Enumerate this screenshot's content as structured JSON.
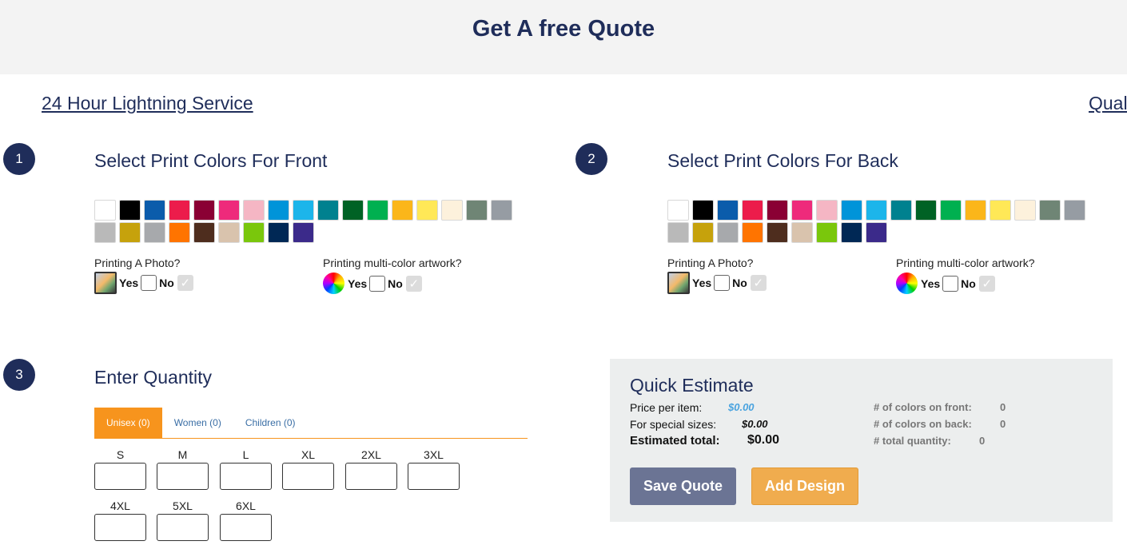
{
  "header": {
    "title": "Get A free Quote"
  },
  "promos": {
    "left": "24 Hour Lightning Service",
    "right": "Qual"
  },
  "steps": {
    "front": "1",
    "back": "2",
    "quantity": "3"
  },
  "front": {
    "title": "Select Print Colors For Front",
    "photo_label": "Printing A Photo?",
    "multicolor_label": "Printing multi-color artwork?",
    "yes": "Yes",
    "no": "No"
  },
  "back": {
    "title": "Select Print Colors For Back",
    "photo_label": "Printing A Photo?",
    "multicolor_label": "Printing multi-color artwork?",
    "yes": "Yes",
    "no": "No"
  },
  "swatch_colors": [
    "#ffffff",
    "#000000",
    "#0b5cab",
    "#ec1c4b",
    "#8a0034",
    "#ee2a7b",
    "#f5b6c4",
    "#0094d9",
    "#1cb5ea",
    "#00818f",
    "#006225",
    "#00b050",
    "#fbb61a",
    "#ffe857",
    "#fdf1dc",
    "#6f8575",
    "#969ca3",
    "#b9b9b9",
    "#c6a20c",
    "#a7a9ac",
    "#ff7400",
    "#4e2d1e",
    "#d9c3ad",
    "#7ac70c",
    "#002855",
    "#3b2a8a"
  ],
  "quantity": {
    "title": "Enter Quantity",
    "tabs": [
      "Unisex (0)",
      "Women (0)",
      "Children (0)"
    ],
    "sizes": [
      "S",
      "M",
      "L",
      "XL",
      "2XL",
      "3XL",
      "4XL",
      "5XL",
      "6XL"
    ]
  },
  "estimate": {
    "title": "Quick Estimate",
    "price_label": "Price per item:",
    "price_value": "$0.00",
    "special_label": "For special sizes:",
    "special_value": "$0.00",
    "total_label": "Estimated total:",
    "total_value": "$0.00",
    "front_colors_label": "# of colors on front:",
    "front_colors_value": "0",
    "back_colors_label": "# of colors on back:",
    "back_colors_value": "0",
    "total_qty_label": "# total quantity:",
    "total_qty_value": "0",
    "save_label": "Save Quote",
    "add_label": "Add Design"
  },
  "colors": {
    "navy": "#1f2d5a",
    "orange": "#f7941d",
    "save_btn": "#6b7494",
    "add_btn": "#f0ac4e"
  }
}
